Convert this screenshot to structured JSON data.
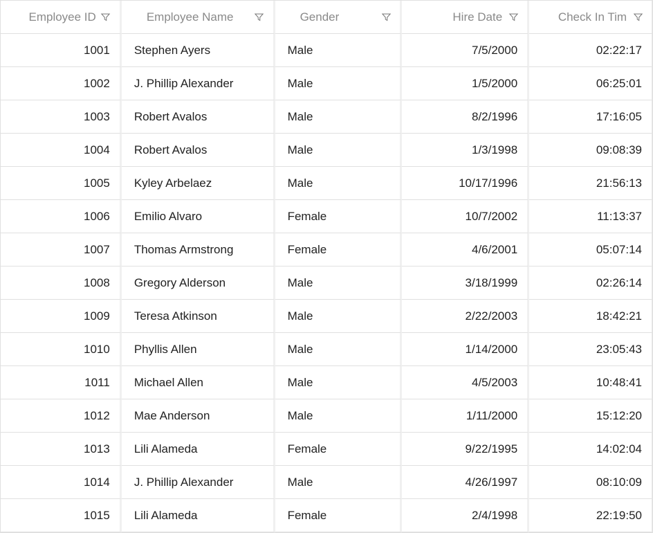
{
  "columns": [
    {
      "key": "id",
      "label": "Employee ID",
      "align": "right",
      "cls": "col-id"
    },
    {
      "key": "name",
      "label": "Employee Name",
      "align": "left",
      "cls": "col-name"
    },
    {
      "key": "gender",
      "label": "Gender",
      "align": "left",
      "cls": "col-gender"
    },
    {
      "key": "hire",
      "label": "Hire Date",
      "align": "right",
      "cls": "col-hire"
    },
    {
      "key": "checkin",
      "label": "Check In Tim",
      "align": "right",
      "cls": "col-chk"
    }
  ],
  "rows": [
    {
      "id": "1001",
      "name": "Stephen Ayers",
      "gender": "Male",
      "hire": "7/5/2000",
      "checkin": "02:22:17"
    },
    {
      "id": "1002",
      "name": "J. Phillip Alexander",
      "gender": "Male",
      "hire": "1/5/2000",
      "checkin": "06:25:01"
    },
    {
      "id": "1003",
      "name": "Robert Avalos",
      "gender": "Male",
      "hire": "8/2/1996",
      "checkin": "17:16:05"
    },
    {
      "id": "1004",
      "name": "Robert Avalos",
      "gender": "Male",
      "hire": "1/3/1998",
      "checkin": "09:08:39"
    },
    {
      "id": "1005",
      "name": "Kyley Arbelaez",
      "gender": "Male",
      "hire": "10/17/1996",
      "checkin": "21:56:13"
    },
    {
      "id": "1006",
      "name": "Emilio Alvaro",
      "gender": "Female",
      "hire": "10/7/2002",
      "checkin": "11:13:37"
    },
    {
      "id": "1007",
      "name": "Thomas Armstrong",
      "gender": "Female",
      "hire": "4/6/2001",
      "checkin": "05:07:14"
    },
    {
      "id": "1008",
      "name": "Gregory Alderson",
      "gender": "Male",
      "hire": "3/18/1999",
      "checkin": "02:26:14"
    },
    {
      "id": "1009",
      "name": "Teresa Atkinson",
      "gender": "Male",
      "hire": "2/22/2003",
      "checkin": "18:42:21"
    },
    {
      "id": "1010",
      "name": "Phyllis Allen",
      "gender": "Male",
      "hire": "1/14/2000",
      "checkin": "23:05:43"
    },
    {
      "id": "1011",
      "name": "Michael Allen",
      "gender": "Male",
      "hire": "4/5/2003",
      "checkin": "10:48:41"
    },
    {
      "id": "1012",
      "name": "Mae Anderson",
      "gender": "Male",
      "hire": "1/11/2000",
      "checkin": "15:12:20"
    },
    {
      "id": "1013",
      "name": "Lili Alameda",
      "gender": "Female",
      "hire": "9/22/1995",
      "checkin": "14:02:04"
    },
    {
      "id": "1014",
      "name": "J. Phillip Alexander",
      "gender": "Male",
      "hire": "4/26/1997",
      "checkin": "08:10:09"
    },
    {
      "id": "1015",
      "name": "Lili Alameda",
      "gender": "Female",
      "hire": "2/4/1998",
      "checkin": "22:19:50"
    }
  ]
}
